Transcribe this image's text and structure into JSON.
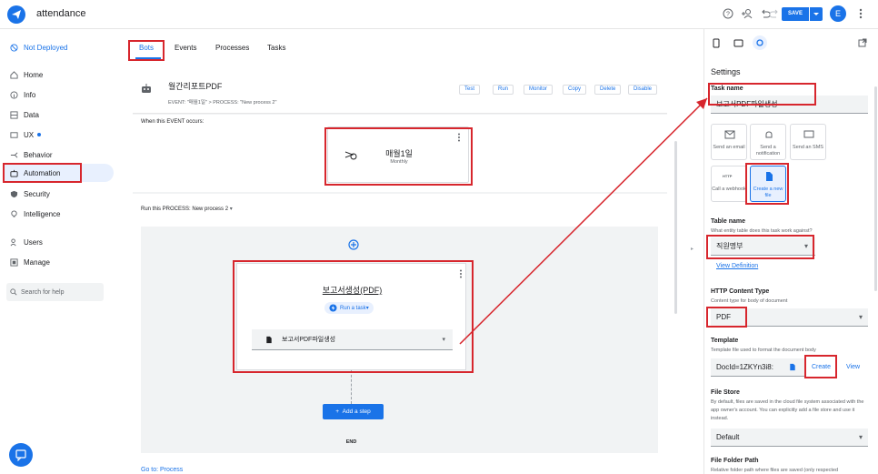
{
  "app": {
    "name": "attendance"
  },
  "toolbar": {
    "save_label": "SAVE",
    "avatar_letter": "E"
  },
  "nav": {
    "deploy_status": "Not Deployed",
    "items": [
      {
        "label": "Home"
      },
      {
        "label": "Info"
      },
      {
        "label": "Data"
      },
      {
        "label": "UX"
      },
      {
        "label": "Behavior"
      },
      {
        "label": "Automation"
      },
      {
        "label": "Security"
      },
      {
        "label": "Intelligence"
      },
      {
        "label": "Users"
      },
      {
        "label": "Manage"
      }
    ],
    "search_placeholder": "Search for help"
  },
  "tabs": [
    "Bots",
    "Events",
    "Processes",
    "Tasks"
  ],
  "bot": {
    "name": "월간리포트PDF",
    "subtitle": "EVENT: \"매월1일\" > PROCESS: \"New process 2\"",
    "actions": [
      "Test",
      "Run",
      "Monitor",
      "Copy",
      "Delete",
      "Disable"
    ],
    "event_heading": "When this EVENT occurs:",
    "event_name": "매월1일",
    "event_schedule": "Monthly",
    "process_heading": "Run this PROCESS:",
    "process_name": "New process 2",
    "step_name": "보고서생성(PDF)",
    "step_type": "Run a task",
    "task_name": "보고서PDF파일생성",
    "add_step": "Add a step",
    "end_label": "END",
    "goto": "Go to: Process"
  },
  "panel": {
    "title": "Settings",
    "task_name_label": "Task name",
    "task_name_value": "보고서PDF파일생성",
    "task_tiles": [
      {
        "label": "Send an email",
        "icon": "email-icon"
      },
      {
        "label": "Send a notification",
        "icon": "bell-icon"
      },
      {
        "label": "Send an SMS",
        "icon": "chat-icon"
      },
      {
        "label": "Call a webhook",
        "icon": "http-icon"
      },
      {
        "label": "Create a new file",
        "icon": "file-icon"
      }
    ],
    "table_label": "Table name",
    "table_help": "What entity table does this task work against?",
    "table_value": "직원명부",
    "view_definition": "View Definition",
    "content_type_label": "HTTP Content Type",
    "content_type_help": "Content type for body of document",
    "content_type_value": "PDF",
    "template_label": "Template",
    "template_help": "Template file used to format the document body",
    "template_value": "DocId=1ZKYn3i8:",
    "create_label": "Create",
    "view_label": "View",
    "file_store_label": "File Store",
    "file_store_help": "By default, files are saved in the cloud file system associated with the app owner's account. You can explicitly add a file store and use it instead.",
    "file_store_value": "Default",
    "folder_label": "File Folder Path",
    "folder_help": "Relative folder path where files are saved (only respected"
  },
  "colors": {
    "accent": "#1a73e8",
    "highlight": "#d7262d"
  }
}
